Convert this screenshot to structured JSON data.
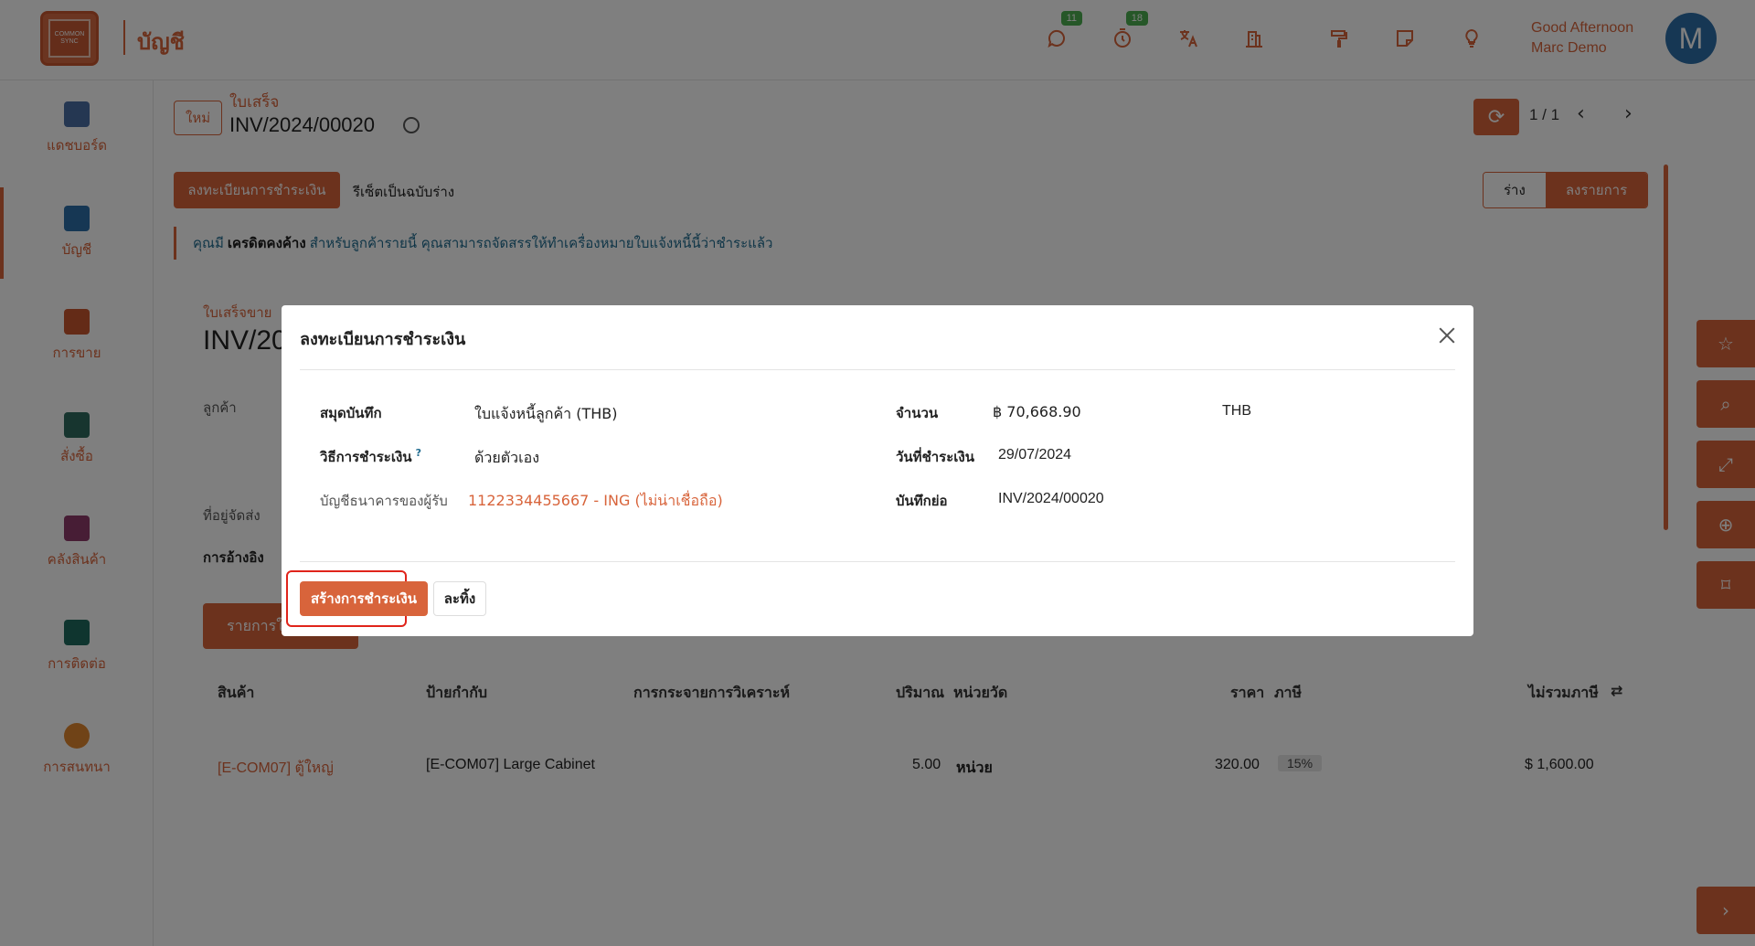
{
  "app": {
    "title": "บัญชี",
    "logo_text": "COMMON SYNC"
  },
  "topbar": {
    "messages_count": "11",
    "activities_count": "18",
    "greeting_line1": "Good Afternoon",
    "greeting_line2": "Marc Demo",
    "avatar_initial": "M"
  },
  "sidebar": {
    "items": [
      {
        "label": "แดชบอร์ด",
        "color": "#4a6fa5"
      },
      {
        "label": "บัญชี",
        "color": "#2d6ea8"
      },
      {
        "label": "การขาย",
        "color": "#c8572f"
      },
      {
        "label": "สั่งซื้อ",
        "color": "#2f6b5e"
      },
      {
        "label": "คลังสินค้า",
        "color": "#8e3b6b"
      },
      {
        "label": "การติดต่อ",
        "color": "#1f6b5e"
      },
      {
        "label": "การสนทนา",
        "color": "#e0872f"
      }
    ]
  },
  "record": {
    "new_badge": "ใหม่",
    "breadcrumb_parent": "ใบเสร็จ",
    "breadcrumb_current": "INV/2024/00020",
    "pager": "1 / 1",
    "register_payment_button": "ลงทะเบียนการชำระเงิน",
    "reset_draft_button": "รีเซ็ตเป็นฉบับร่าง",
    "status_draft": "ร่าง",
    "status_posted": "ลงรายการ",
    "alert_prefix": "คุณมี",
    "alert_bold": "เครดิตคงค้าง",
    "alert_suffix": "สำหรับลูกค้ารายนี้ คุณสามารถจัดสรรให้ทำเครื่องหมายใบแจ้งหนี้นี้ว่าชำระแล้ว",
    "sheet_label": "ใบเสร็จขาย",
    "sheet_title": "INV/20",
    "customer_label": "ลูกค้า",
    "delivery_address_label": "ที่อยู่จัดส่ง",
    "reference_label": "การอ้างอิง",
    "invoice_lines_tab": "รายการใ"
  },
  "lines_table": {
    "headers": {
      "product": "สินค้า",
      "label": "ป้ายกำกับ",
      "analytic": "การกระจายการวิเคราะห์",
      "quantity": "ปริมาณ",
      "uom": "หน่วยวัด",
      "price": "ราคา",
      "taxes": "ภาษี",
      "subtotal": "ไม่รวมภาษี"
    },
    "rows": [
      {
        "product": "[E-COM07] ตู้ใหญ่",
        "label": "[E-COM07] Large Cabinet",
        "quantity": "5.00",
        "uom": "หน่วย",
        "price": "320.00",
        "tax": "15%",
        "subtotal": "$ 1,600.00"
      }
    ]
  },
  "modal": {
    "title": "ลงทะเบียนการชำระเงิน",
    "journal_label": "สมุดบันทึก",
    "journal_value": "ใบแจ้งหนี้ลูกค้า (THB)",
    "payment_method_label": "วิธีการชำระเงิน",
    "payment_method_help": "?",
    "payment_method_value": "ด้วยตัวเอง",
    "recipient_bank_label": "บัญชีธนาคารของผู้รับ",
    "recipient_bank_value": "1122334455667 - ING (ไม่น่าเชื่อถือ)",
    "amount_label": "จำนวน",
    "amount_value": "฿ 70,668.90",
    "currency_value": "THB",
    "payment_date_label": "วันที่ชำระเงิน",
    "payment_date_value": "29/07/2024",
    "memo_label": "บันทึกย่อ",
    "memo_value": "INV/2024/00020",
    "create_button": "สร้างการชำระเงิน",
    "discard_button": "ละทิ้ง"
  }
}
